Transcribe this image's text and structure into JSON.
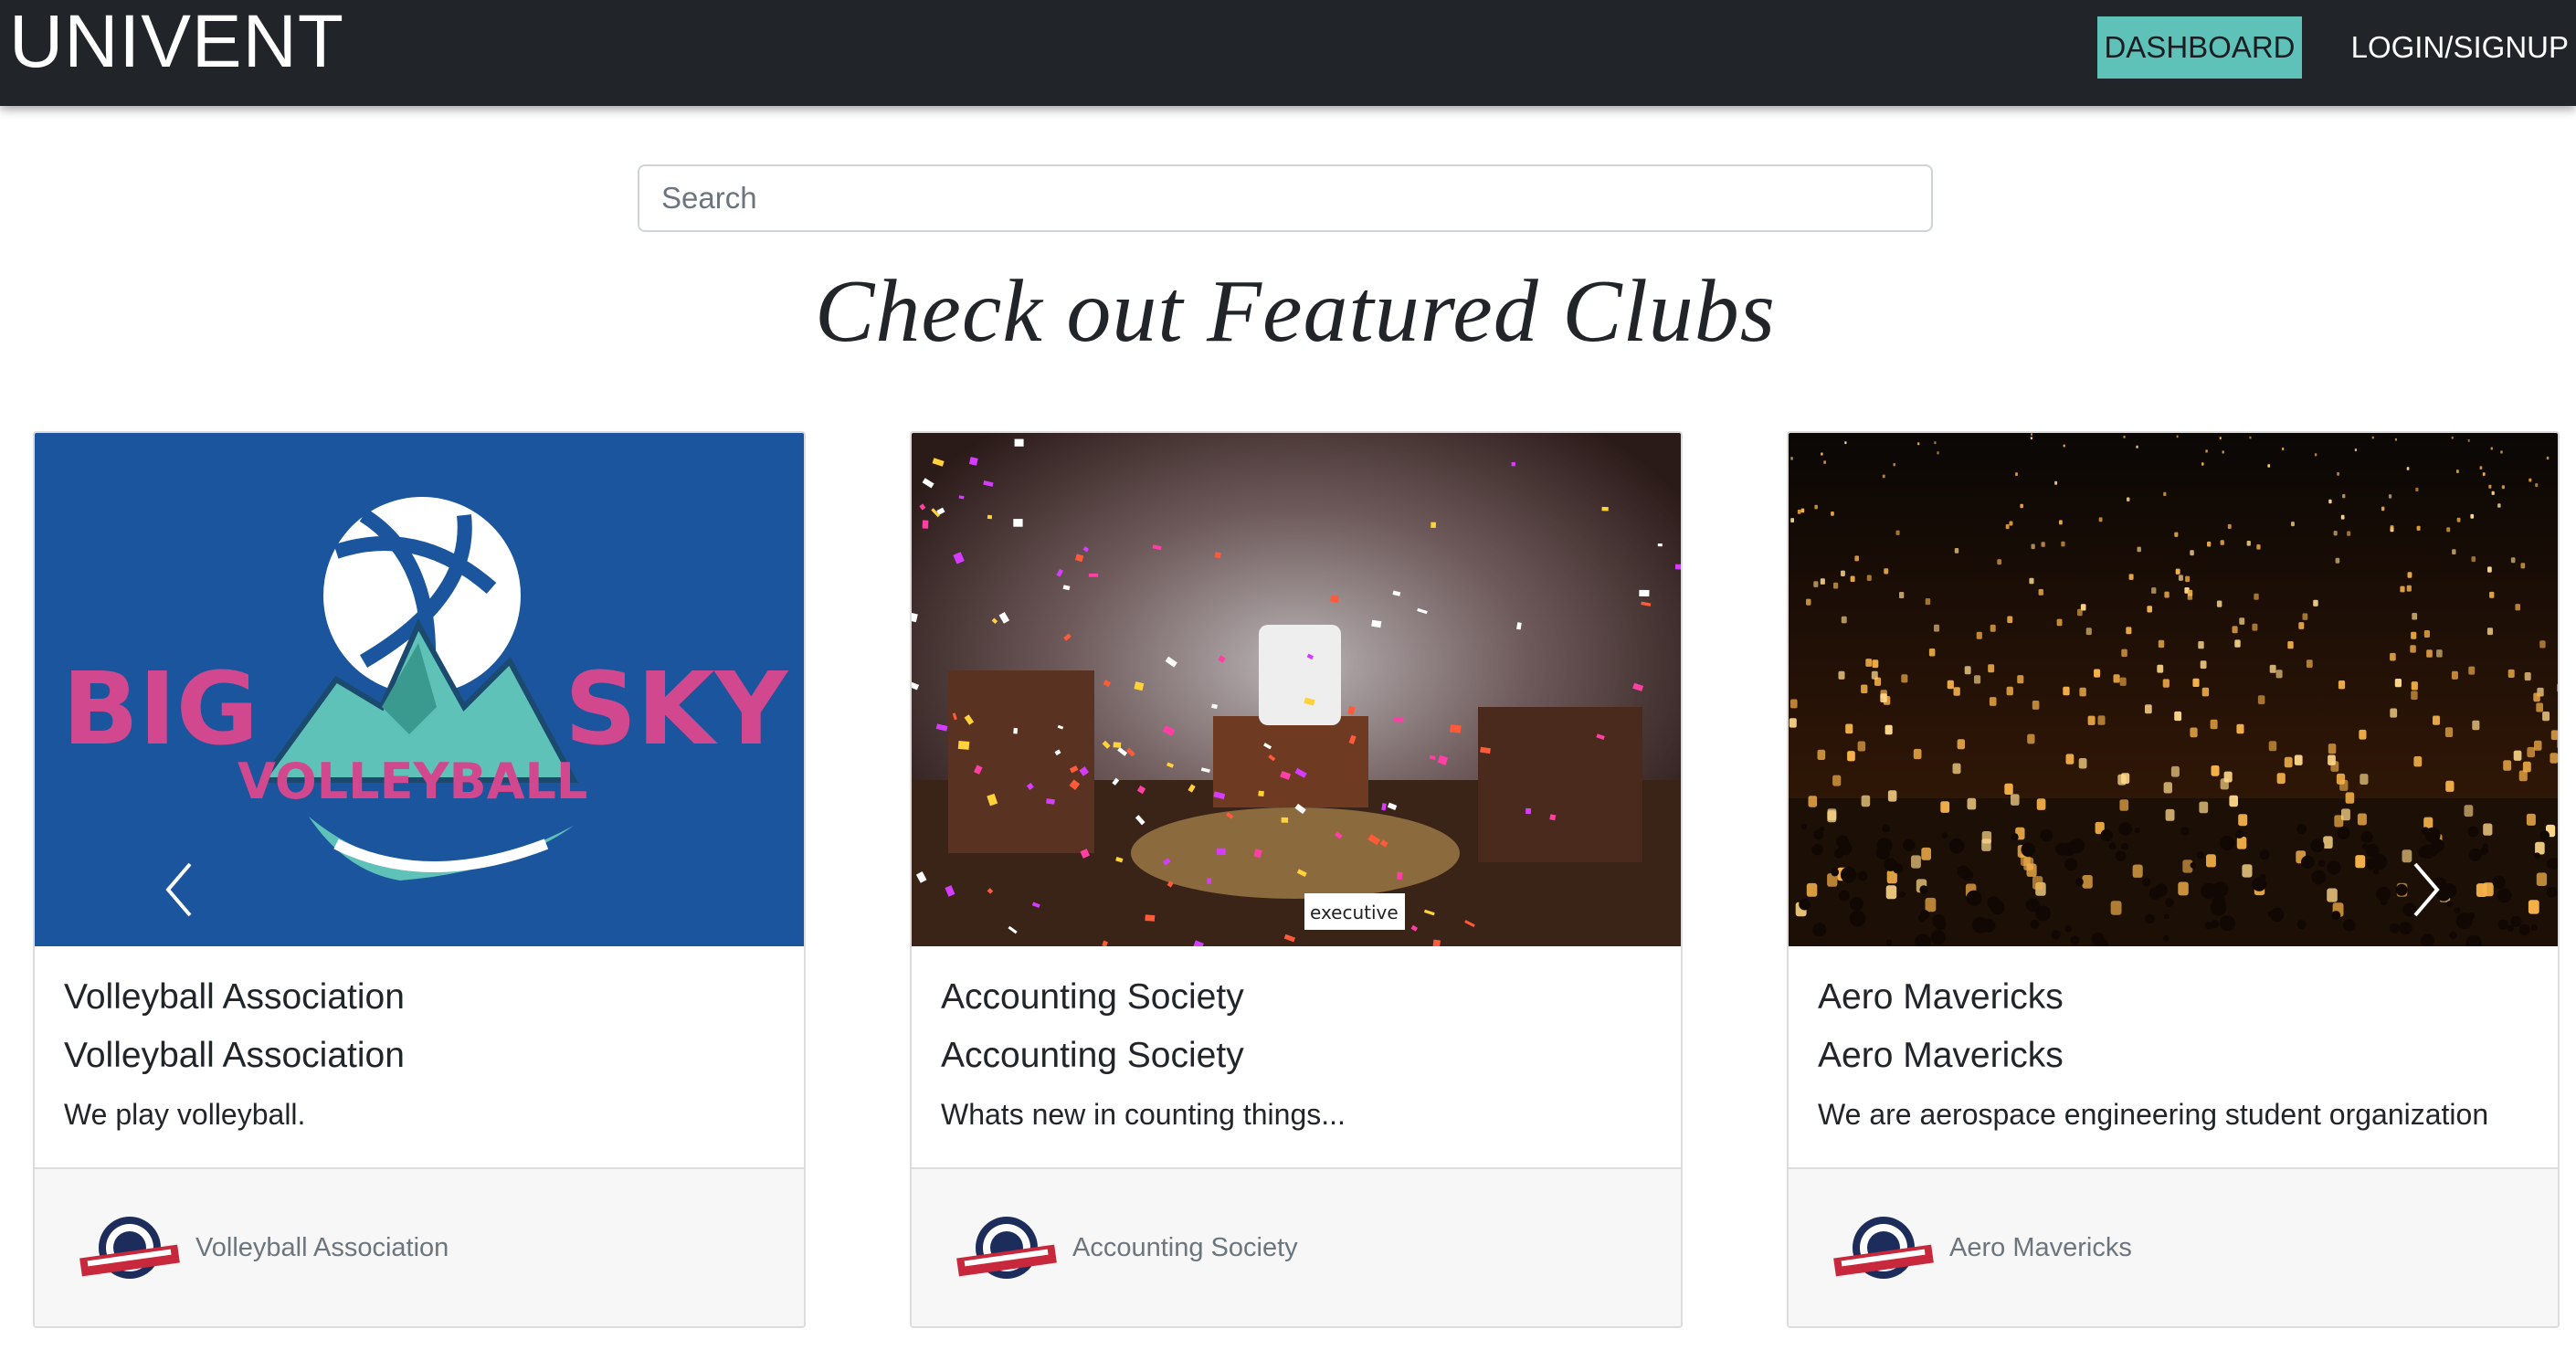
{
  "navbar": {
    "brand": "UNIVENT",
    "dashboard_label": "DASHBOARD",
    "login_label": "LOGIN/SIGNUP",
    "dashboard_color": "#5fc2b8",
    "background_color": "#212429"
  },
  "search": {
    "placeholder": "Search"
  },
  "heading": "Check out Featured Clubs",
  "cards": [
    {
      "image_text_top": "BIG",
      "image_text_right": "SKY",
      "image_text_bottom": "VOLLEYBALL",
      "title": "Volleyball Association",
      "subtitle": "Volleyball Association",
      "text": "We play volleyball.",
      "footer_name": "Volleyball Association"
    },
    {
      "image_text": "executive",
      "title": "Accounting Society",
      "subtitle": "Accounting Society",
      "text": "Whats new in counting things...",
      "footer_name": "Accounting Society"
    },
    {
      "title": "Aero Mavericks",
      "subtitle": "Aero Mavericks",
      "text": "We are aerospace engineering student organization",
      "footer_name": "Aero Mavericks"
    }
  ],
  "carousel": {
    "prev_icon": "chevron-left-icon",
    "next_icon": "chevron-right-icon"
  }
}
